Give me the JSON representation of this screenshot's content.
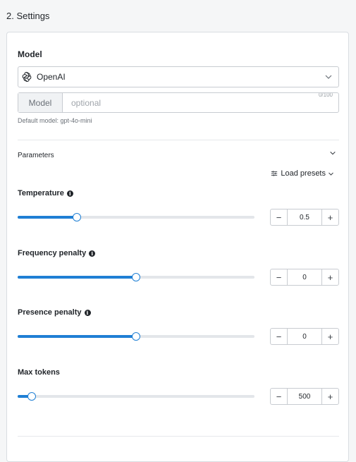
{
  "section": {
    "title": "2. Settings"
  },
  "model": {
    "label": "Model",
    "provider": "OpenAI",
    "provider_icon": "openai-logo-icon",
    "input_addon": "Model",
    "input_placeholder": "optional",
    "input_value": "",
    "counter": "0/100",
    "default_hint": "Default model: gpt-4o-mini"
  },
  "parameters": {
    "label": "Parameters",
    "presets_label": "Load presets",
    "items": [
      {
        "label": "Temperature",
        "value": "0.5",
        "level": 0.25
      },
      {
        "label": "Frequency penalty",
        "value": "0",
        "level": 0.5
      },
      {
        "label": "Presence penalty",
        "value": "0",
        "level": 0.5
      },
      {
        "label": "Max tokens",
        "value": "500",
        "level": 0.06
      }
    ]
  },
  "colors": {
    "accent": "#1f7fd4",
    "track": "#e3e6ea"
  }
}
